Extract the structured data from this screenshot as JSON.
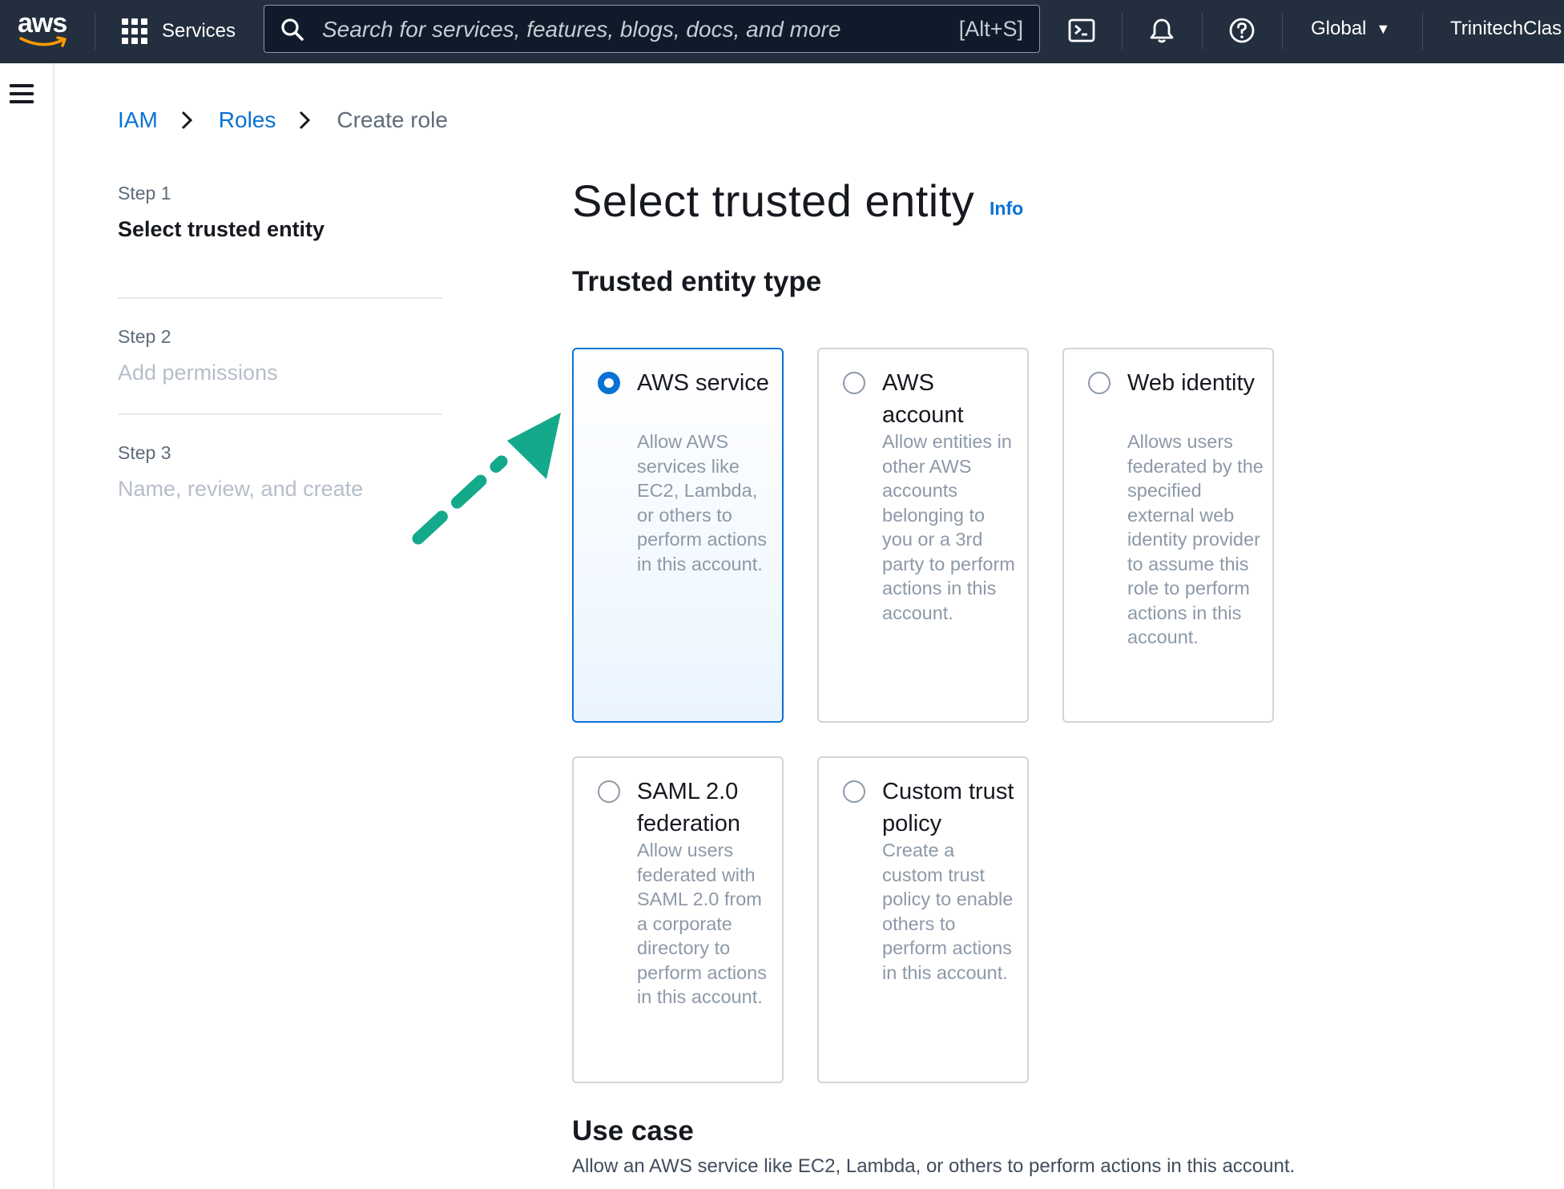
{
  "topnav": {
    "logo_text": "aws",
    "services_label": "Services",
    "search_placeholder": "Search for services, features, blogs, docs, and more",
    "search_shortcut": "[Alt+S]",
    "region": "Global",
    "account": "TrinitechClas"
  },
  "breadcrumb": {
    "items": [
      "IAM",
      "Roles"
    ],
    "current": "Create role"
  },
  "steps": [
    {
      "number": "Step 1",
      "title": "Select trusted entity"
    },
    {
      "number": "Step 2",
      "title": "Add permissions"
    },
    {
      "number": "Step 3",
      "title": "Name, review, and create"
    }
  ],
  "page": {
    "title": "Select trusted entity",
    "info": "Info",
    "section_title": "Trusted entity type"
  },
  "tiles": [
    {
      "label": "AWS service",
      "desc": "Allow AWS services like EC2, Lambda, or others to perform actions in this account.",
      "selected": true
    },
    {
      "label": "AWS account",
      "desc": "Allow entities in other AWS accounts belonging to you or a 3rd party to perform actions in this account.",
      "selected": false
    },
    {
      "label": "Web identity",
      "desc": "Allows users federated by the specified external web identity provider to assume this role to perform actions in this account.",
      "selected": false
    },
    {
      "label": "SAML 2.0 federation",
      "desc": "Allow users federated with SAML 2.0 from a corporate directory to perform actions in this account.",
      "selected": false
    },
    {
      "label": "Custom trust policy",
      "desc": "Create a custom trust policy to enable others to perform actions in this account.",
      "selected": false
    }
  ],
  "use_case": {
    "title": "Use case",
    "desc": "Allow an AWS service like EC2, Lambda, or others to perform actions in this account."
  },
  "colors": {
    "nav_bg": "#232f3e",
    "link": "#0972d3",
    "selected_border": "#0972d3",
    "annotation_arrow": "#14a98b"
  }
}
